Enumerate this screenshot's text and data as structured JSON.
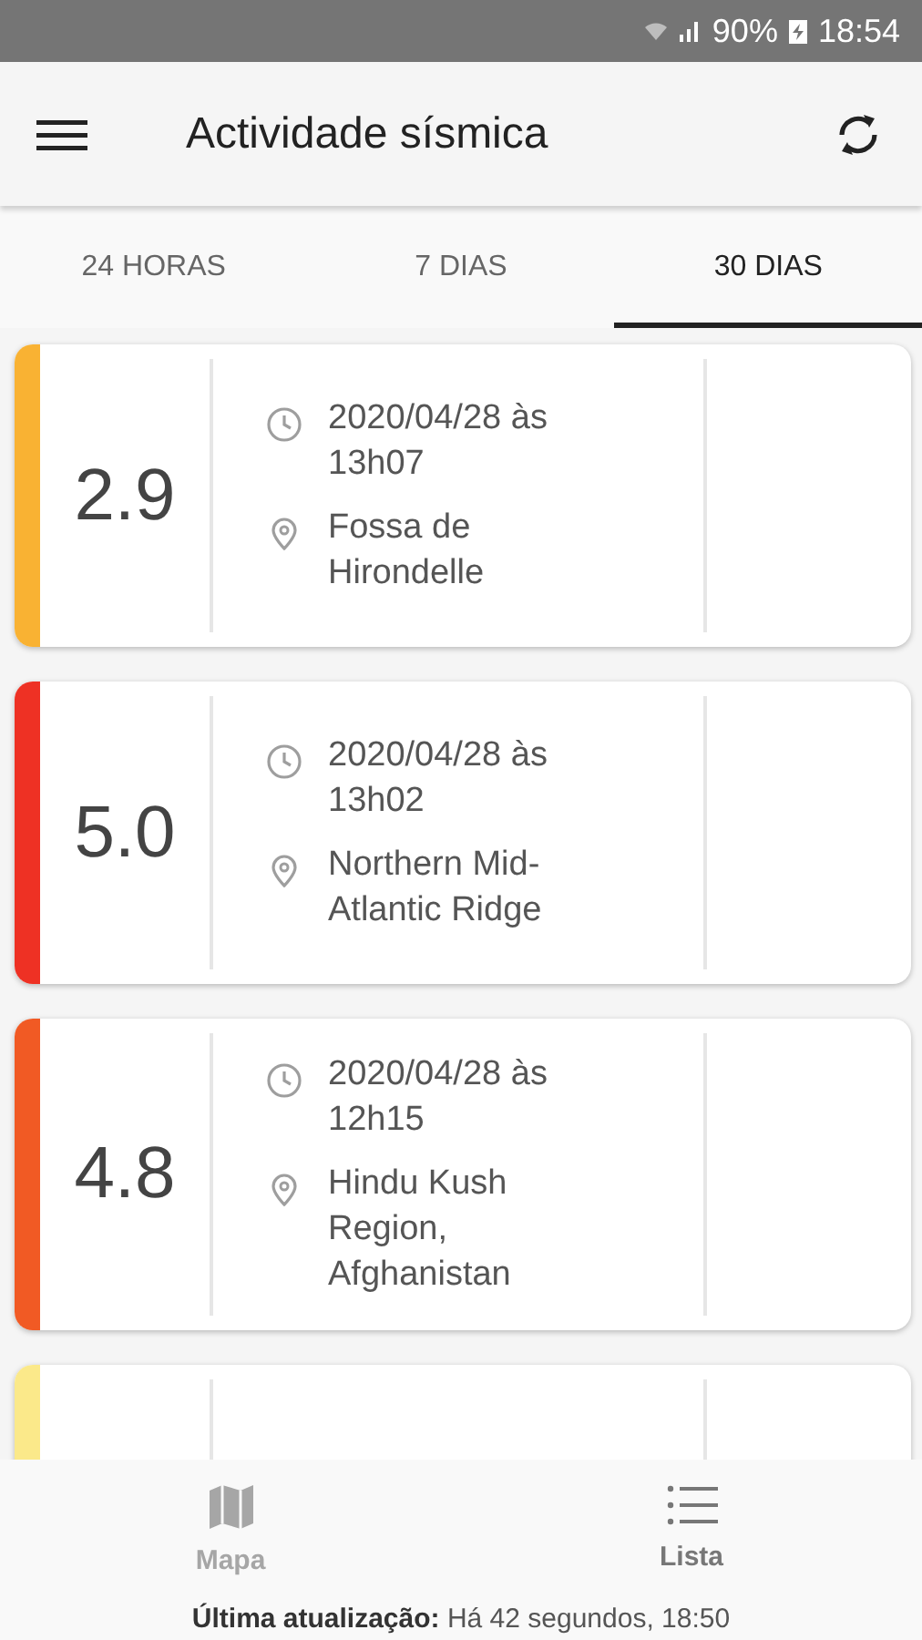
{
  "status_bar": {
    "battery": "90%",
    "time": "18:54"
  },
  "app_bar": {
    "title": "Actividade sísmica"
  },
  "tabs": [
    {
      "label": "24 HORAS",
      "selected": false
    },
    {
      "label": "7 DIAS",
      "selected": false
    },
    {
      "label": "30 DIAS",
      "selected": true
    }
  ],
  "quakes": [
    {
      "magnitude": "2.9",
      "time": "2020/04/28 às 13h07",
      "place": "Fossa de Hirondelle",
      "color": "#f9b233"
    },
    {
      "magnitude": "5.0",
      "time": "2020/04/28 às 13h02",
      "place": "Northern Mid-Atlantic Ridge",
      "color": "#ee3124"
    },
    {
      "magnitude": "4.8",
      "time": "2020/04/28 às 12h15",
      "place": "Hindu Kush Region, Afghanistan",
      "color": "#f15a24"
    },
    {
      "color": "#fbe98a"
    }
  ],
  "bottom_nav": [
    {
      "label": "Mapa",
      "selected": false,
      "kind": "map"
    },
    {
      "label": "Lista",
      "selected": true,
      "kind": "list"
    }
  ],
  "last_update": {
    "label": "Última atualização:",
    "value": "Há 42 segundos, 18:50"
  }
}
